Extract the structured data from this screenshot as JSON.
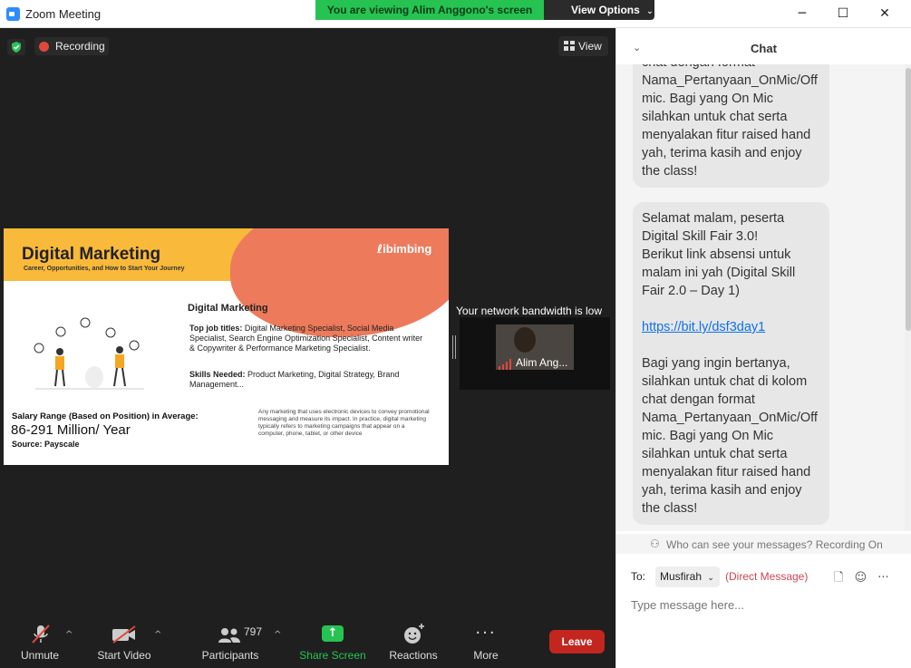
{
  "window": {
    "title": "Zoom Meeting",
    "controls": {
      "minimize": "─",
      "maximize": "☐",
      "close": "✕"
    }
  },
  "banner": {
    "viewing_text": "You are viewing Alim Anggono's screen",
    "view_options_label": "View Options",
    "accent": "#27c352"
  },
  "meeting": {
    "recording_label": "Recording",
    "view_label": "View"
  },
  "shared_slide": {
    "title": "Digital Marketing",
    "subtitle": "Career, Opportunities, and How to Start Your Journey",
    "brand": "ibimbing",
    "section_heading": "Digital Marketing",
    "jobs_label": "Top job titles:",
    "jobs_text": " Digital Marketing Specialist, Social Media Specialist, Search Engine Optimization Specialist, Content writer & Copywriter & Performance Marketing Specialist.",
    "skills_label": "Skills Needed:",
    "skills_text": " Product Marketing, Digital Strategy, Brand Management...",
    "salary_label": "Salary Range (Based on Position) in Average:",
    "salary_range": "86-291 Million/ Year",
    "salary_source": "Source: Payscale",
    "description": "Any marketing that uses electronic devices to convey promotional messaging and measure its impact. In practice, digital marketing typically refers to marketing campaigns that appear on a computer, phone, tablet, or other device"
  },
  "participant_video": {
    "bandwidth_warning": "Your network bandwidth is low",
    "name": "Alim Ang..."
  },
  "toolbar": {
    "unmute": "Unmute",
    "start_video": "Start Video",
    "participants": "Participants",
    "participant_count": "797",
    "share_screen": "Share Screen",
    "reactions": "Reactions",
    "more": "More",
    "leave": "Leave",
    "share_color": "#27c352",
    "leave_color": "#c2261f"
  },
  "chat": {
    "title": "Chat",
    "messages": [
      {
        "text": "chat dengan format Nama_Pertanyaan_OnMic/Off mic. Bagi yang On Mic silahkan untuk chat serta menyalakan fitur raised hand yah, terima kasih and enjoy the class!"
      },
      {
        "text_before": "Selamat malam, peserta Digital Skill Fair 3.0!\nBerikut link absensi untuk malam ini yah (Digital Skill Fair 2.0 – Day 1)\n\n",
        "link": "https://bit.ly/dsf3day1",
        "text_after": "\n\nBagi yang ingin bertanya, silahkan untuk chat di kolom chat dengan format Nama_Pertanyaan_OnMic/Off mic. Bagi yang On Mic silahkan untuk chat serta menyalakan fitur raised hand yah, terima kasih and enjoy the class!"
      }
    ],
    "visibility_notice": "Who can see your messages? Recording On",
    "to_label": "To:",
    "recipient": "Musfirah",
    "dm_label": "(Direct Message)",
    "input_placeholder": "Type message here..."
  }
}
